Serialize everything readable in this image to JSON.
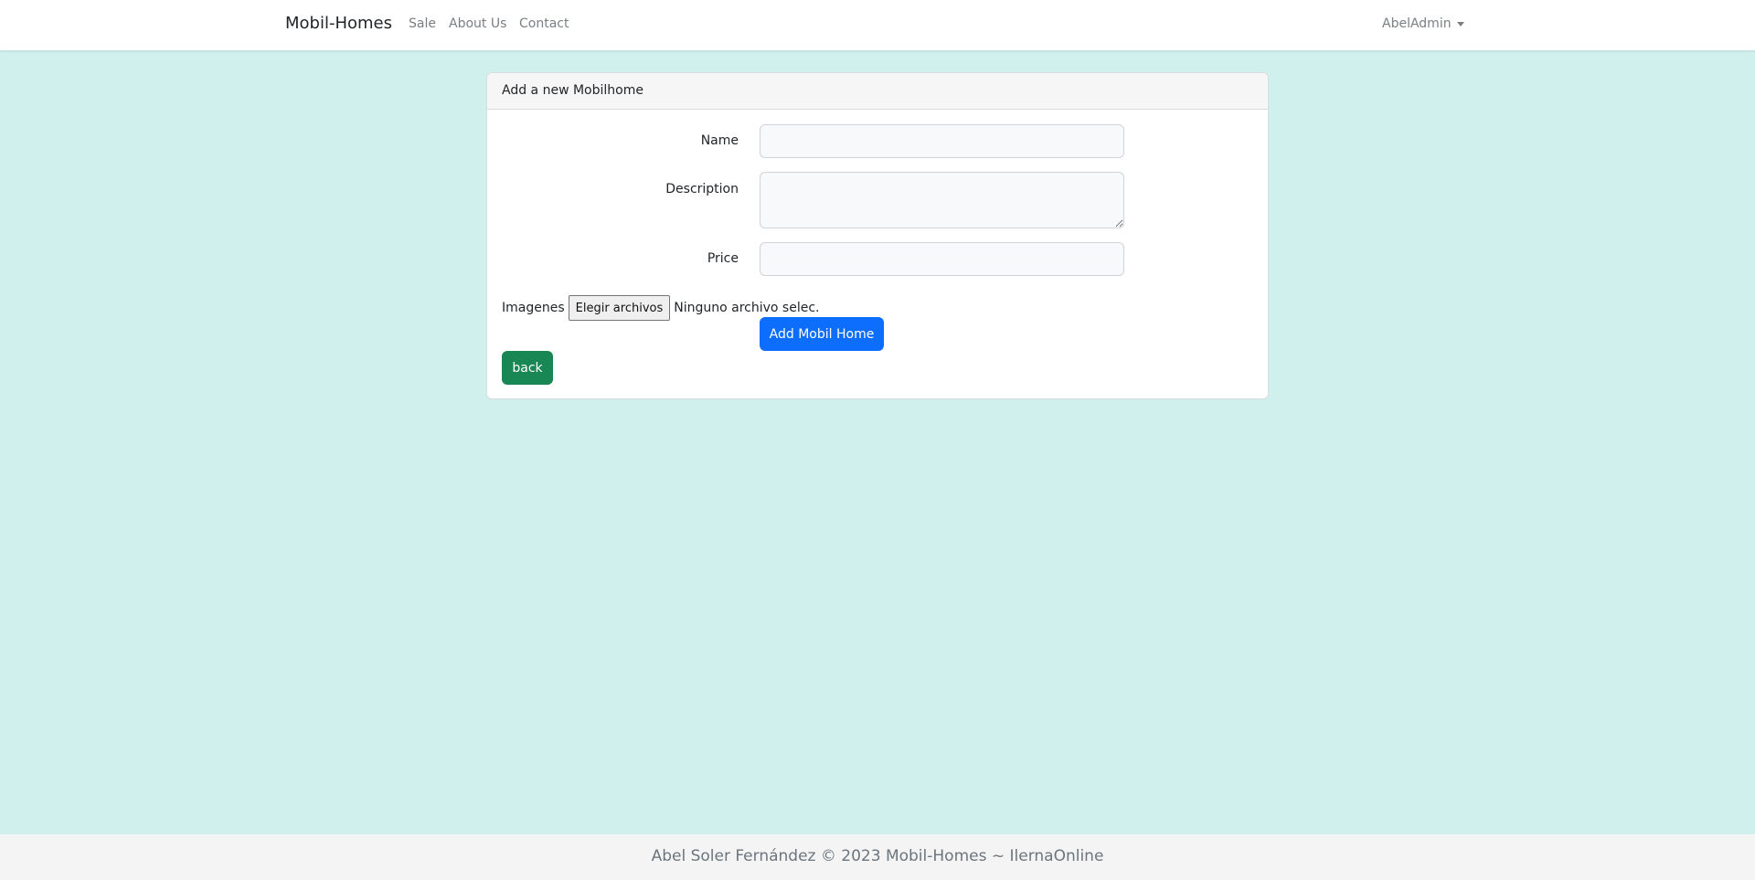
{
  "navbar": {
    "brand": "Mobil-Homes",
    "links": [
      "Sale",
      "About Us",
      "Contact"
    ],
    "user": "AbelAdmin"
  },
  "card": {
    "header": "Add a new Mobilhome",
    "fields": {
      "name_label": "Name",
      "name_value": "",
      "description_label": "Description",
      "description_value": "",
      "price_label": "Price",
      "price_value": ""
    },
    "images": {
      "label": "Imagenes",
      "button_label": "Elegir archivos",
      "status": "Ninguno archivo selec."
    },
    "submit_label": "Add Mobil Home",
    "back_label": "back"
  },
  "colors": {
    "page_bg": "#cff0ed",
    "primary": "#0d6efd",
    "success": "#198754"
  },
  "footer": {
    "text": "Abel Soler Fernández © 2023 Mobil-Homes ~ IlernaOnline"
  }
}
